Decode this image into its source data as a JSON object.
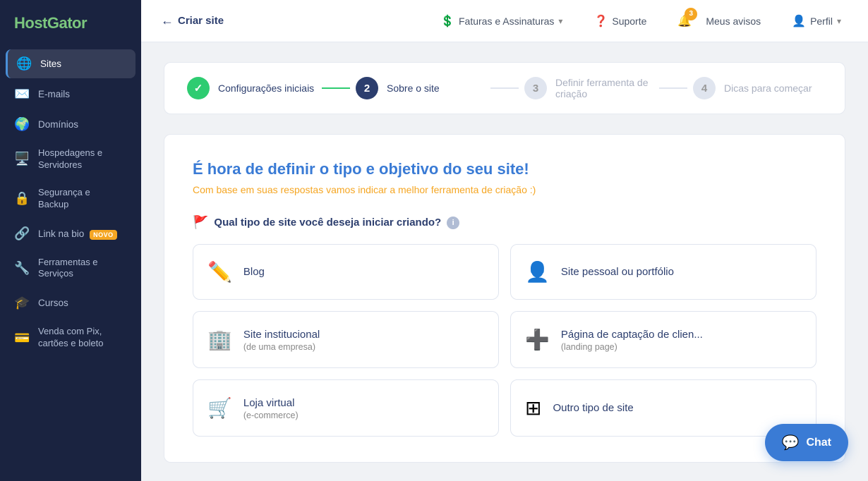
{
  "brand": {
    "name_part1": "Host",
    "name_part2": "Gator"
  },
  "sidebar": {
    "items": [
      {
        "id": "sites",
        "label": "Sites",
        "icon": "🌐",
        "active": true
      },
      {
        "id": "emails",
        "label": "E-mails",
        "icon": "✉️",
        "active": false
      },
      {
        "id": "dominios",
        "label": "Domínios",
        "icon": "🔗",
        "active": false
      },
      {
        "id": "hospedagens",
        "label1": "Hospedagens e",
        "label2": "Servidores",
        "icon": "🖥️",
        "active": false,
        "multi": true
      },
      {
        "id": "seguranca",
        "label1": "Segurança e",
        "label2": "Backup",
        "icon": "🔒",
        "active": false,
        "multi": true
      },
      {
        "id": "link-na-bio",
        "label": "Link na bio",
        "icon": "🔗",
        "active": false,
        "badge": "NOVO"
      },
      {
        "id": "ferramentas",
        "label1": "Ferramentas e",
        "label2": "Serviços",
        "icon": "🔧",
        "active": false,
        "multi": true
      },
      {
        "id": "cursos",
        "label": "Cursos",
        "icon": "🎓",
        "active": false
      },
      {
        "id": "venda-pix",
        "label1": "Venda com Pix,",
        "label2": "cartões e boleto",
        "icon": "💳",
        "active": false,
        "multi": true
      }
    ]
  },
  "topnav": {
    "back_label": "Criar site",
    "faturas_label": "Faturas e Assinaturas",
    "suporte_label": "Suporte",
    "avisos_label": "Meus avisos",
    "perfil_label": "Perfil",
    "notif_count": "3"
  },
  "steps": [
    {
      "id": "step1",
      "num": "✓",
      "label": "Configurações iniciais",
      "state": "done"
    },
    {
      "id": "step2",
      "num": "2",
      "label": "Sobre o site",
      "state": "active"
    },
    {
      "id": "step3",
      "num": "3",
      "label": "Definir ferramenta de criação",
      "state": "inactive"
    },
    {
      "id": "step4",
      "num": "4",
      "label": "Dicas para começar",
      "state": "inactive"
    }
  ],
  "page": {
    "title_normal": "É hora de ",
    "title_highlight": "definir o tipo e objetivo do seu site!",
    "subtitle_normal": "Com base em suas respostas vamos indicar a melhor ferramenta de ",
    "subtitle_highlight": "criação",
    "subtitle_end": " :)",
    "section_label": "Qual tipo de site você deseja iniciar criando?",
    "options": [
      {
        "id": "blog",
        "icon": "✏️",
        "label": "Blog",
        "sub": ""
      },
      {
        "id": "pessoal",
        "icon": "👤",
        "label": "Site pessoal ou portfólio",
        "sub": ""
      },
      {
        "id": "institucional",
        "icon": "🏢",
        "label": "Site institucional",
        "sub": "(de uma empresa)"
      },
      {
        "id": "landing",
        "icon": "➕",
        "label": "Página de captação de clien...",
        "sub": "(landing page)"
      },
      {
        "id": "loja",
        "icon": "🛒",
        "label": "Loja virtual",
        "sub": "(e-commerce)"
      },
      {
        "id": "outro",
        "icon": "⊞",
        "label": "Outro tipo de site",
        "sub": ""
      }
    ]
  },
  "chat": {
    "label": "Chat"
  }
}
